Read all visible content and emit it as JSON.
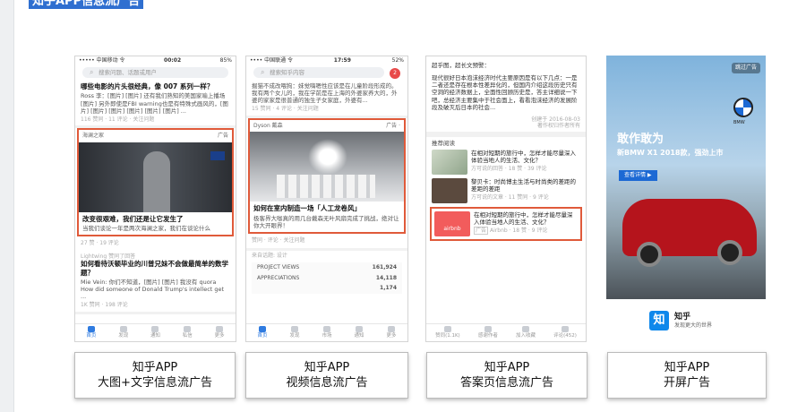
{
  "page_title": "知乎APP信息流广告",
  "colors": {
    "accent": "#2f7be0",
    "ad_border": "#e05a3a",
    "title_bg": "#2f6fd0"
  },
  "captions": [
    {
      "line1": "知乎APP",
      "line2": "大图+文字信息流广告"
    },
    {
      "line1": "知乎APP",
      "line2": "视频信息流广告"
    },
    {
      "line1": "知乎APP",
      "line2": "答案页信息流广告"
    },
    {
      "line1": "知乎APP",
      "line2": "开屏广告"
    }
  ],
  "phone1": {
    "status_left": "••••• 中国移动 令",
    "status_time": "00:02",
    "status_right": "85%",
    "search_placeholder": "搜索问题、话题或用户",
    "item1_title": "哪些电影的片头很经典，像 007 系列一样？",
    "item1_text": "Ross 李：[图片] [图片] 还有我们熟知的美国家喻上播场 [图片] 另外即使是FBI warning也是有特殊式画风的，[图片] [图片] [图片] [图片] [图片] [图片] ...",
    "item1_meta": "116 赞同 · 11 评论 · 关注问题",
    "ad_source": "海澜之家",
    "ad_tag": "广告",
    "ad_title": "改变很艰难，我们还是让它发生了",
    "ad_text": "当我们谈论一年是两次海澜之家，我们在谈论什么",
    "ad_meta": "27 赞 · 19 评论",
    "item2_source": "Lightwing 赞同了回答",
    "item2_title": "如何看待沃顿毕业的川普兄妹不会做最简单的数学题？",
    "item2_text": "Mie Vein: 你们不知道，[图片] [图片] 我没有 quora How did someone of Donald Trump's intellect get ...",
    "item2_meta": "1K 赞同 · 198 评论",
    "tabs": [
      "首页",
      "发现",
      "通知",
      "私信",
      "更多"
    ]
  },
  "phone2": {
    "status_left": "•••• 中国联通 令",
    "status_time": "17:59",
    "status_right": "52%",
    "search_placeholder": "搜索知乎内容",
    "badge": "2",
    "top_text": "掘猫不成改喂狗：妹觉嗨嗯性应该是在儿童阶段形成的。我有两个女儿的，我在学前是在上海的外婆家养大的，外婆的家家是很普通的独生子女家庭，外婆有...",
    "top_meta": "15 赞同 · 4 评论 · 关注问题",
    "ad_source": "Dyson 戴森",
    "ad_tag": "广告 ·",
    "ad_title": "如何在室内制造一场「人工龙卷风」",
    "ad_text": "极客界大咖真的用几台戴森无叶风扇完成了挑战，绝对让你大开眼界！",
    "ad_meta": "赞同 · 评论 · 关注问题",
    "item_source": "来自话题: 设计",
    "stats": [
      {
        "label": "PROJECT VIEWS",
        "value": "161,924"
      },
      {
        "label": "APPRECIATIONS",
        "value": "14,118"
      },
      {
        "label": "",
        "value": "1,174"
      }
    ],
    "tabs": [
      "首页",
      "发现",
      "市场",
      "通知",
      "更多"
    ]
  },
  "phone3": {
    "header": "超乎图，超长文预警：",
    "body": "现代很好日本泡沫经济时代主要原因是有以下几点：一是二者还是存在根本性差异化的，但国内介绍这段历史只有空洞的经济数据上，全面性回顾历史是，答主详细说一下吧，总经济主要集中于社会面上，看看泡沫经济的发展阶段及破灭后日本的社会...",
    "date": "创建于 2016-08-03",
    "copyright": "著作权归作者所有",
    "rec_title": "推荐阅读",
    "recs": [
      {
        "title": "在相对短期的旅行中，怎样才能尽量深入体验当地人的生活、文化？",
        "meta": "方可说的回答 · 18 赞 · 39 评论"
      },
      {
        "title": "黎贝卡：时尚博主生活与时尚类的差距的差距的差距",
        "meta": "方可说的文章 · 11 赞同 · 9 评论"
      }
    ],
    "ad": {
      "title": "在相对短期的旅行中，怎样才能尽量深入体验当地人的生活、文化？",
      "source": "Airbnb · 18 赞 · 9 评论",
      "tag": "广告",
      "logo": "airbnb"
    },
    "bottom": [
      "赞同(1.1K)",
      "感谢作者",
      "加入收藏",
      "评论(452)"
    ]
  },
  "phone4": {
    "skip": "跳过广告",
    "headline": "敢作敢为",
    "subline": "新BMW X1 2018款，强劲上市",
    "cta": "查看详情 ▶",
    "brand": "BMW",
    "app_icon": "知",
    "app_name": "知乎",
    "app_slogan": "发现更大的世界"
  }
}
